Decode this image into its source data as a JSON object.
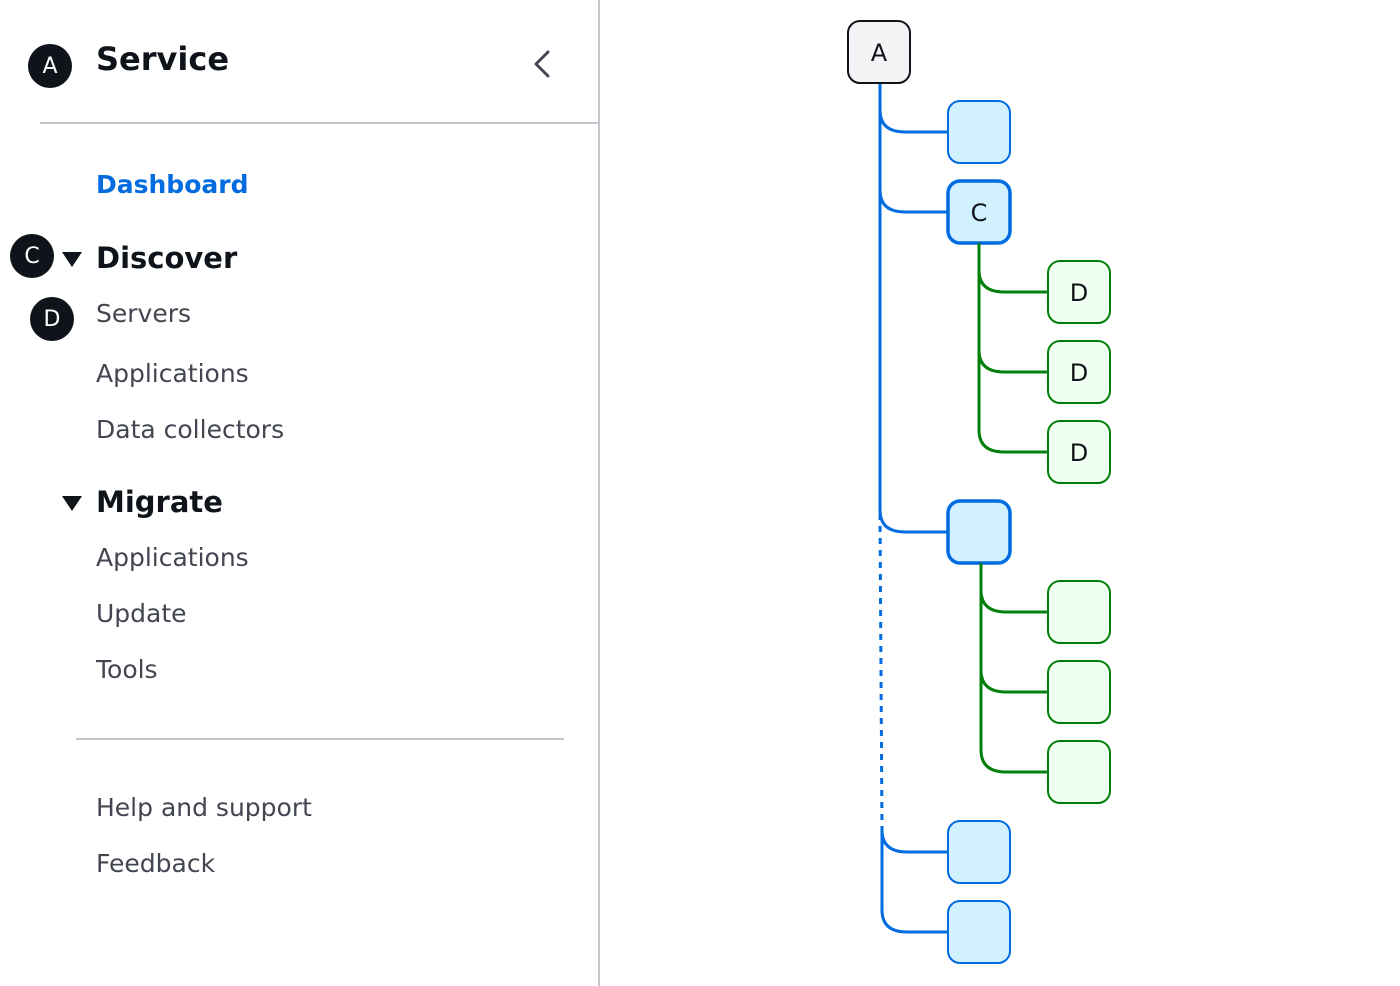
{
  "sidebar": {
    "header": {
      "badge": "A",
      "title": "Service",
      "collapse_icon": "chevron-left-icon"
    },
    "nav": {
      "dashboard": "Dashboard",
      "discover": {
        "badge": "C",
        "label": "Discover",
        "items": [
          {
            "label": "Servers",
            "badge": "D"
          },
          {
            "label": "Applications"
          },
          {
            "label": "Data collectors"
          }
        ]
      },
      "migrate": {
        "label": "Migrate",
        "items": [
          {
            "label": "Applications"
          },
          {
            "label": "Update"
          },
          {
            "label": "Tools"
          }
        ]
      }
    },
    "footer": [
      {
        "label": "Help and support"
      },
      {
        "label": "Feedback"
      }
    ]
  },
  "diagram": {
    "colors": {
      "root_fill": "#f4f4f6",
      "root_stroke": "#0f141a",
      "blue_fill": "#d1f1ff",
      "blue_stroke": "#006ce0",
      "green_fill": "#effff1",
      "green_stroke": "#037f0c"
    },
    "root": {
      "label": "A"
    },
    "children": [
      {
        "label": "",
        "selected": false,
        "children": []
      },
      {
        "label": "C",
        "selected": true,
        "children": [
          {
            "label": "D"
          },
          {
            "label": "D"
          },
          {
            "label": "D"
          }
        ]
      },
      {
        "label": "",
        "selected": true,
        "children": [
          {
            "label": ""
          },
          {
            "label": ""
          },
          {
            "label": ""
          }
        ]
      },
      {
        "label": "",
        "selected": false,
        "children": [],
        "gap_before": true
      },
      {
        "label": "",
        "selected": false,
        "children": []
      }
    ]
  }
}
